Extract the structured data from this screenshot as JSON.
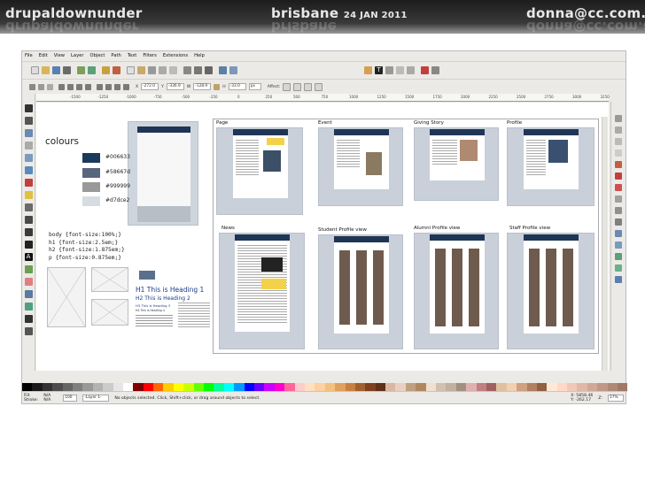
{
  "banner": {
    "left_text": "drupaldownunder",
    "middle_city": "brisbane",
    "middle_date": "24 JAN 2011",
    "right_text": "donna@cc.com.au"
  },
  "menu": [
    "File",
    "Edit",
    "View",
    "Layer",
    "Object",
    "Path",
    "Text",
    "Filters",
    "Extensions",
    "Help"
  ],
  "toolbar2": {
    "x_label": "X",
    "x_value": "-272.0",
    "y_label": "Y",
    "y_value": "-336.9",
    "w_label": "W",
    "w_value": "-128.9",
    "h_label": "H",
    "h_value": "-33.0",
    "unit": "px",
    "affect_label": "Affect:"
  },
  "ruler_ticks": [
    "-1500",
    "-1250",
    "-1000",
    "-750",
    "-500",
    "-250",
    "0",
    "250",
    "500",
    "750",
    "1000",
    "1250",
    "1500",
    "1750",
    "2000",
    "2250",
    "2500",
    "2750",
    "3000",
    "3250"
  ],
  "canvas": {
    "colours_heading": "colours",
    "swatches": [
      {
        "hex": "#006633",
        "color": "#1a3a5c"
      },
      {
        "hex": "#58667d",
        "color": "#58667d"
      },
      {
        "hex": "#999999",
        "color": "#999999"
      },
      {
        "hex": "#d7dce2",
        "color": "#d7dce2"
      }
    ],
    "css_lines": [
      "body {font-size:100%;}",
      "h1 {font-size:2.5em;}",
      "h2 {font-size:1.875em;}",
      "p {font-size:0.875em;}"
    ],
    "headings": {
      "h1": "H1 This is Heading 1",
      "h2": "H2 This is Heading 2",
      "h3": "H3 This is Heading 3",
      "h4": "H4 This is Heading 4"
    },
    "mockups": [
      "Page",
      "Event",
      "Giving Story",
      "Profile",
      "News",
      "Student Profile view",
      "Alumni Profile view",
      "Staff Profile view"
    ]
  },
  "status": {
    "fill_label": "Fill:",
    "fill_value": "N/A",
    "stroke_label": "Stroke:",
    "stroke_value": "N/A",
    "opacity": "100",
    "layer": "-Layer 1-",
    "message": "No objects selected. Click, Shift+click, or drag around objects to select.",
    "coords_x": "X: 5858.46",
    "coords_y": "Y: -262.17",
    "zoom_label": "Z:",
    "zoom": "17%"
  },
  "palette": [
    "#000000",
    "#1a1a1a",
    "#333333",
    "#4d4d4d",
    "#666666",
    "#808080",
    "#999999",
    "#b3b3b3",
    "#cccccc",
    "#e6e6e6",
    "#ffffff",
    "#800000",
    "#ff0000",
    "#ff6600",
    "#ffcc00",
    "#ffff00",
    "#ccff00",
    "#66ff00",
    "#00ff00",
    "#00ff99",
    "#00ffff",
    "#0099ff",
    "#0000ff",
    "#6600ff",
    "#cc00ff",
    "#ff00cc",
    "#ff6699",
    "#ffcccc",
    "#ffe0c0",
    "#ffd0a0",
    "#f4c080",
    "#e0a060",
    "#c88040",
    "#a06030",
    "#804020",
    "#603018",
    "#d8b8a0",
    "#e8d0c0",
    "#c0a080",
    "#b08860",
    "#f0e0d0",
    "#d0c0b0",
    "#c0b0a0",
    "#a09080",
    "#e0b0b0",
    "#c08080",
    "#a06060",
    "#e0c0a0",
    "#f0d0b0",
    "#d0a080",
    "#b08060",
    "#906040",
    "#ffe8d8",
    "#ffd8c8",
    "#f0c8b8",
    "#e0b8a8",
    "#d0a898",
    "#c09888",
    "#b08878",
    "#a07868"
  ]
}
